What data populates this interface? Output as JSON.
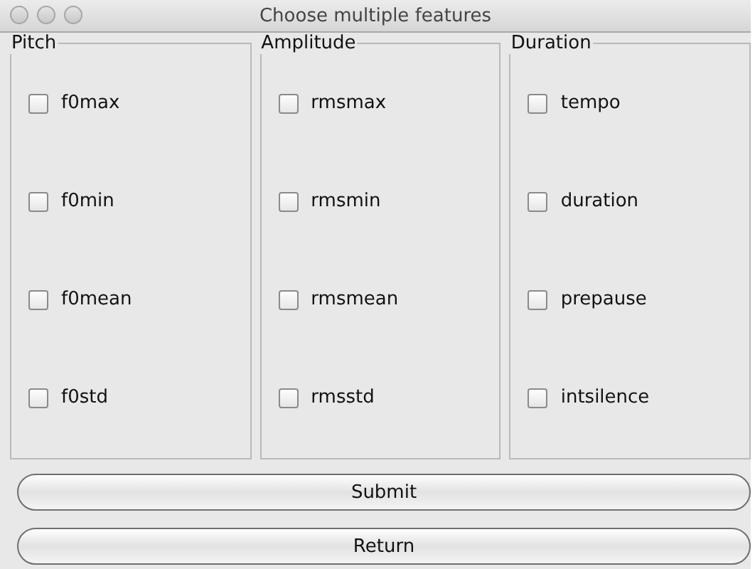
{
  "window": {
    "title": "Choose multiple features"
  },
  "groups": [
    {
      "title": "Pitch",
      "options": [
        {
          "label": "f0max",
          "checked": false
        },
        {
          "label": "f0min",
          "checked": false
        },
        {
          "label": "f0mean",
          "checked": false
        },
        {
          "label": "f0std",
          "checked": false
        }
      ]
    },
    {
      "title": "Amplitude",
      "options": [
        {
          "label": "rmsmax",
          "checked": false
        },
        {
          "label": "rmsmin",
          "checked": false
        },
        {
          "label": "rmsmean",
          "checked": false
        },
        {
          "label": "rmsstd",
          "checked": false
        }
      ]
    },
    {
      "title": "Duration",
      "options": [
        {
          "label": "tempo",
          "checked": false
        },
        {
          "label": "duration",
          "checked": false
        },
        {
          "label": "prepause",
          "checked": false
        },
        {
          "label": "intsilence",
          "checked": false
        }
      ]
    }
  ],
  "buttons": [
    "Submit",
    "Return"
  ]
}
